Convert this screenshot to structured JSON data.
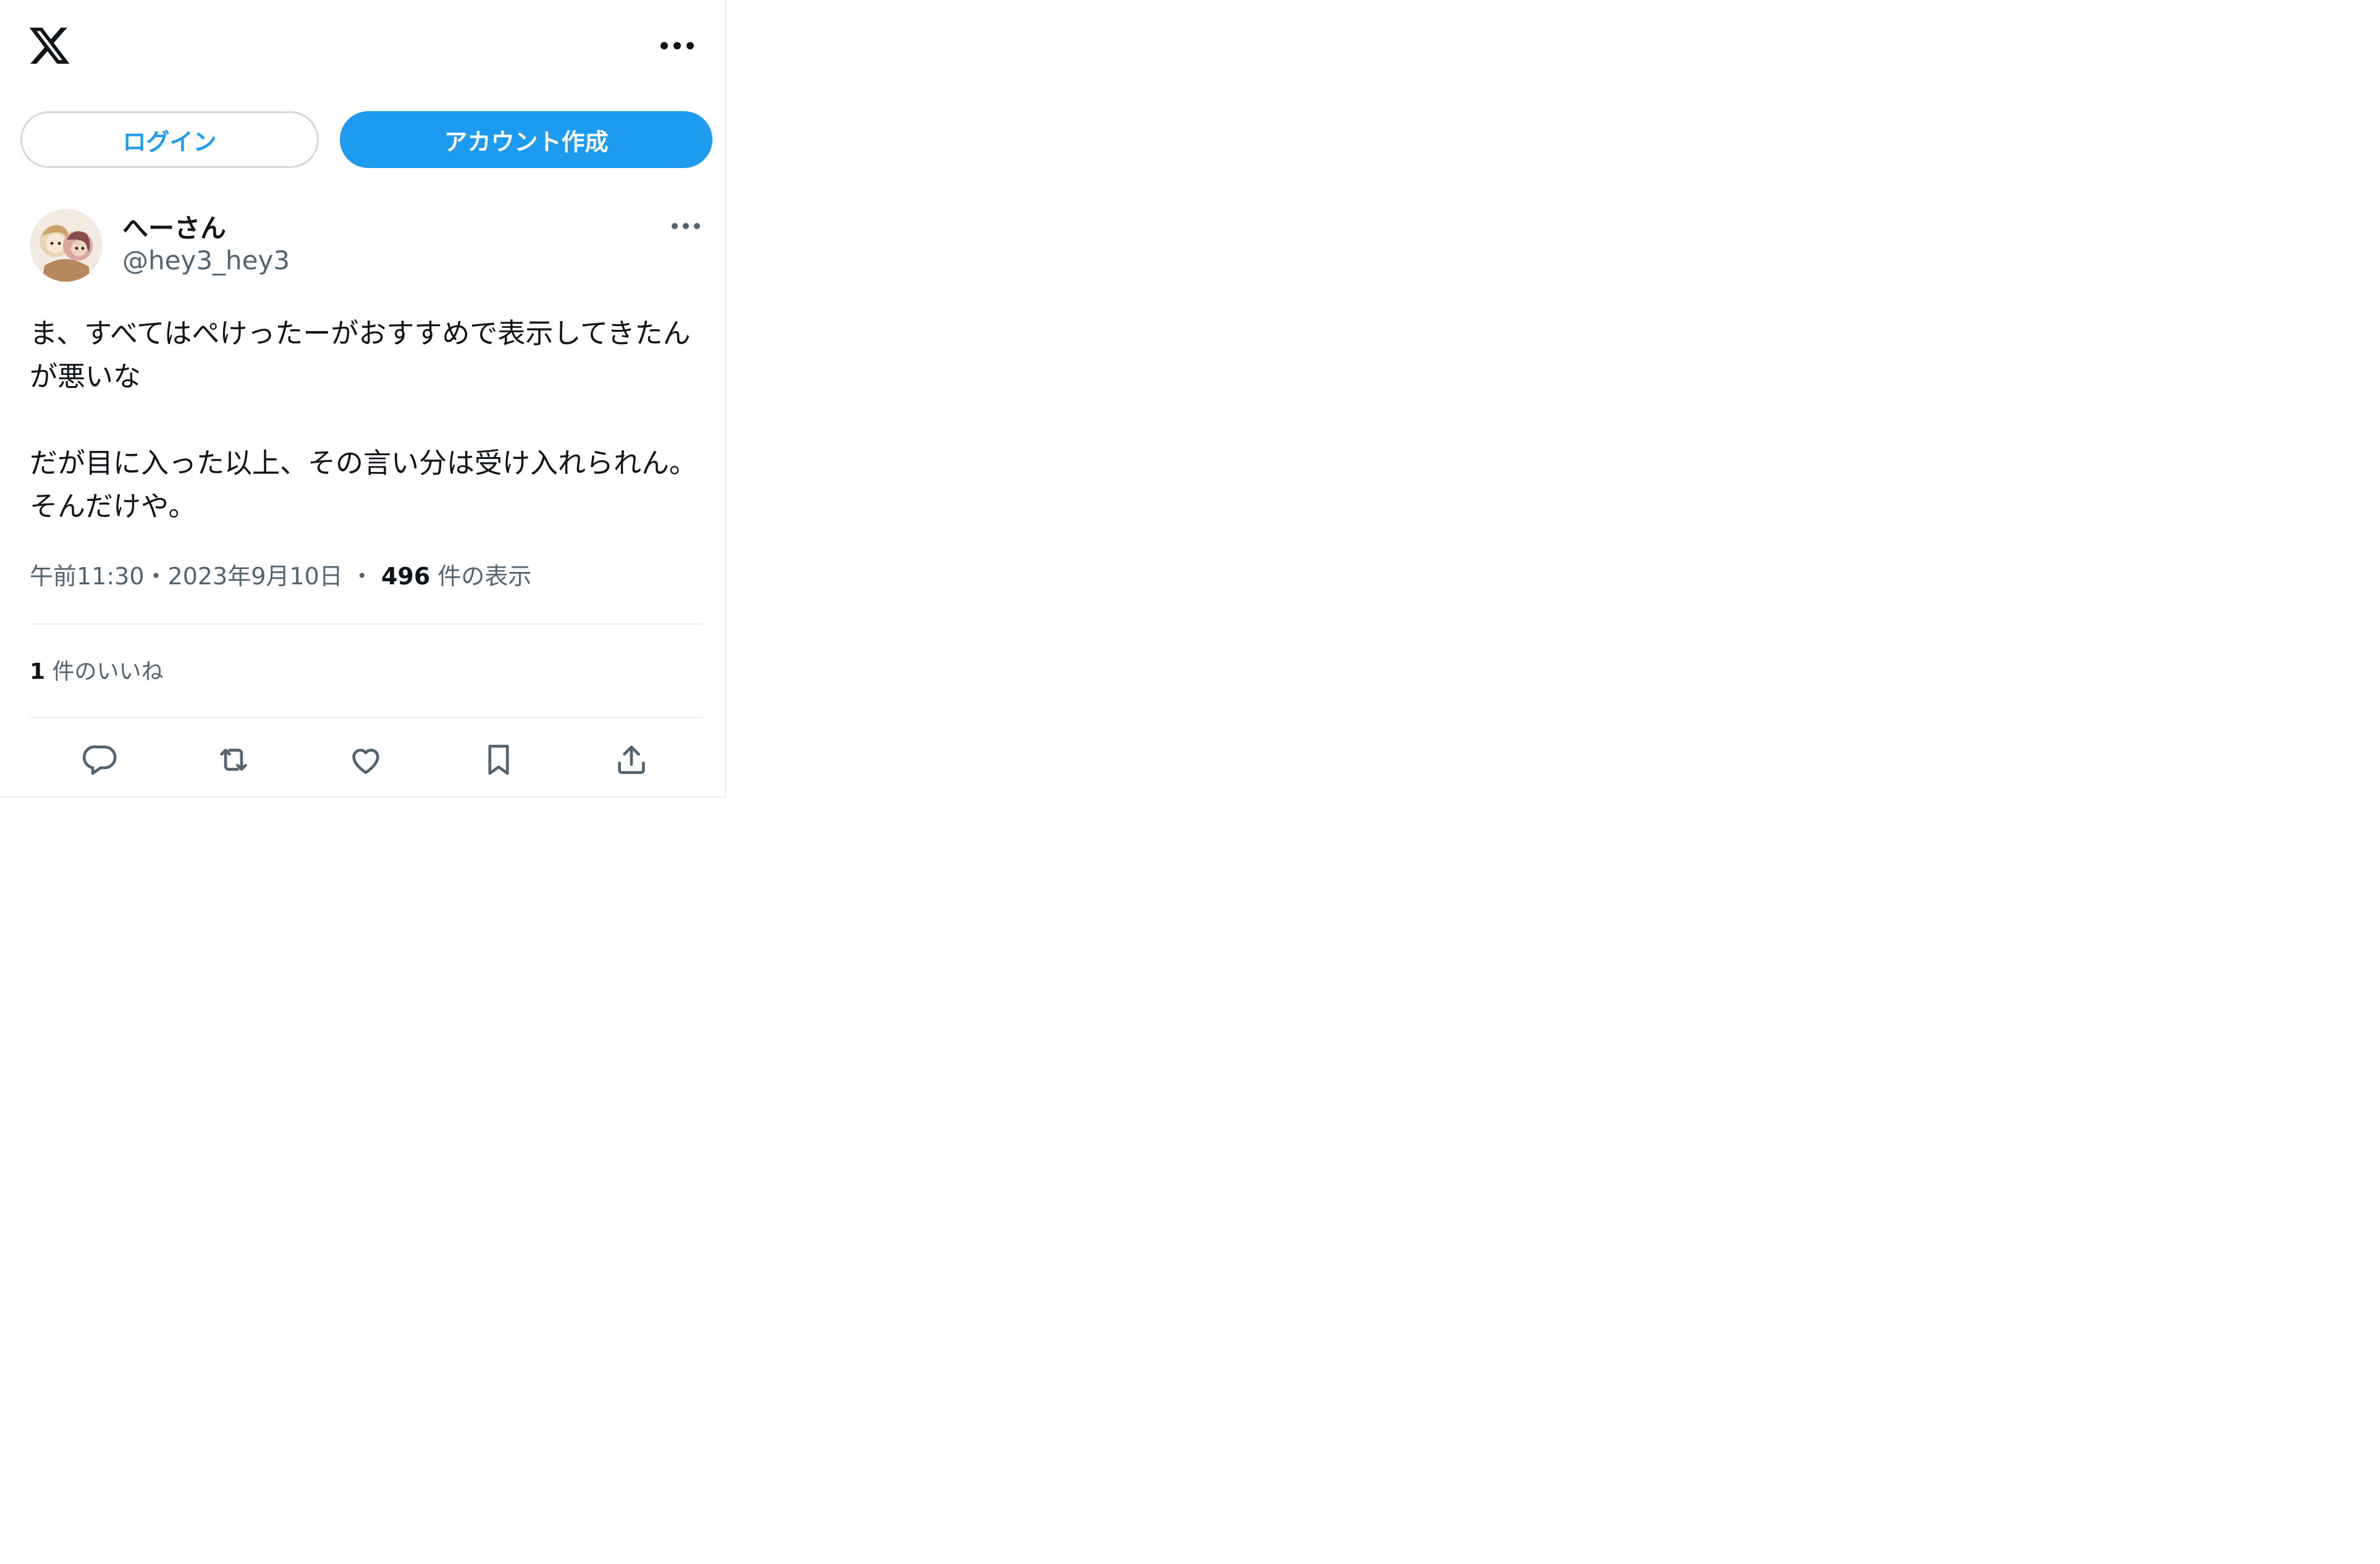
{
  "header": {
    "logo_icon": "x-logo-icon",
    "more_icon": "more-horizontal-icon"
  },
  "auth": {
    "login_label": "ログイン",
    "signup_label": "アカウント作成"
  },
  "post": {
    "display_name": "へーさん",
    "handle": "@hey3_hey3",
    "avatar_icon": "avatar-illustration",
    "more_icon": "more-horizontal-icon",
    "text": "ま、すべてはぺけったーがおすすめで表示してきたんが悪いな\n\nだが目に入った以上、その言い分は受け入れられん。そんだけや。",
    "time": "午前11:30",
    "separator": "・",
    "date": "2023年9月10日",
    "views_count": "496",
    "views_label": "件の表示",
    "likes_count": "1",
    "likes_label": "件のいいね"
  },
  "actions": [
    {
      "icon": "reply-icon"
    },
    {
      "icon": "repost-icon"
    },
    {
      "icon": "like-icon"
    },
    {
      "icon": "bookmark-icon"
    },
    {
      "icon": "share-icon"
    }
  ],
  "colors": {
    "accent": "#1d9bf0",
    "text_primary": "#0f1419",
    "text_secondary": "#536471",
    "border": "#cfd9de",
    "divider": "#eff3f4"
  }
}
